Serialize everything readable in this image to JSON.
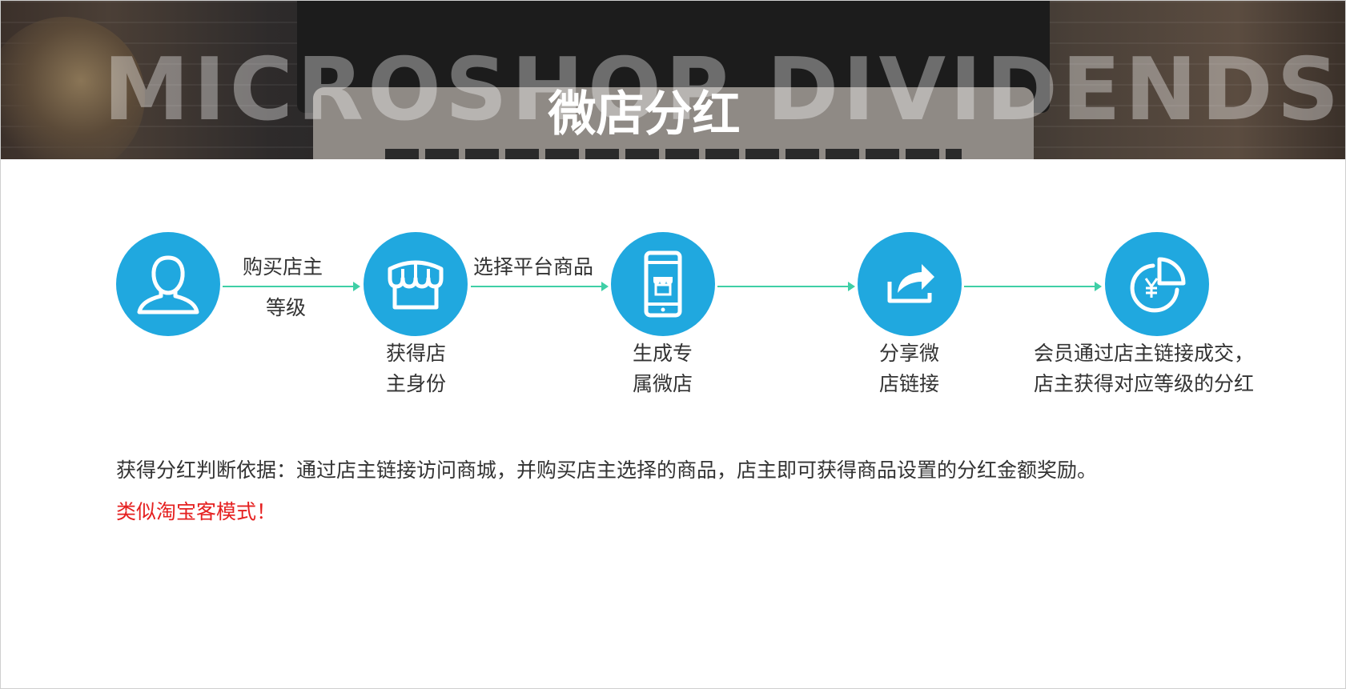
{
  "banner": {
    "bg_text": "MICROSHOP DIVIDENDS",
    "title": "微店分红"
  },
  "colors": {
    "accent": "#20a8df",
    "arrow": "#3fcfa6",
    "highlight": "#e52020"
  },
  "flow": {
    "steps": [
      {
        "icon": "user-icon",
        "label_line1": "",
        "label_line2": ""
      },
      {
        "icon": "storefront-icon",
        "label_line1": "获得店",
        "label_line2": "主身份"
      },
      {
        "icon": "mobile-shop-icon",
        "label_line1": "生成专",
        "label_line2": "属微店"
      },
      {
        "icon": "share-icon",
        "label_line1": "分享微",
        "label_line2": "店链接"
      },
      {
        "icon": "yuan-chart-icon",
        "label_line1": "会员通过店主链接成交，",
        "label_line2": "店主获得对应等级的分红"
      }
    ],
    "arrow_labels": [
      {
        "line1": "购买店主",
        "line2": "等级"
      },
      {
        "line1": "选择平台商品",
        "line2": ""
      }
    ]
  },
  "description": "获得分红判断依据：通过店主链接访问商城，并购买店主选择的商品，店主即可获得商品设置的分红金额奖励。",
  "note": "类似淘宝客模式！"
}
